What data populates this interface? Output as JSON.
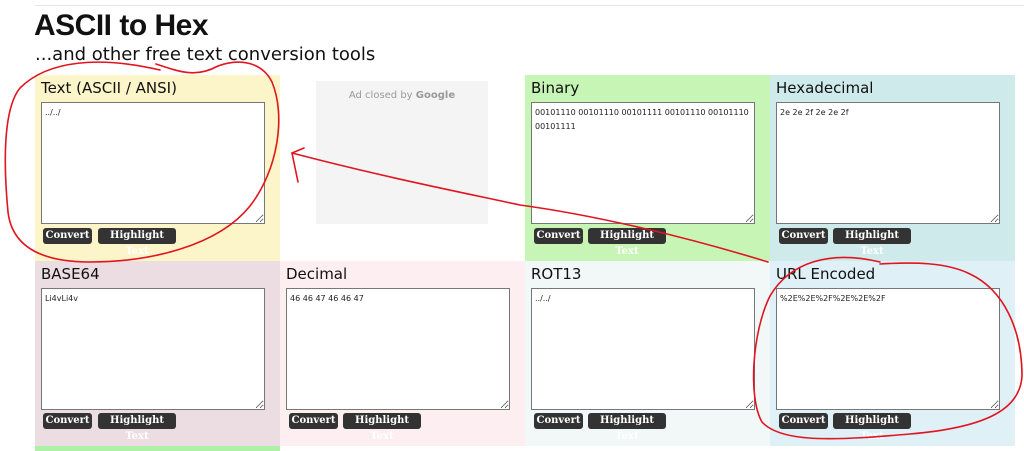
{
  "header": {
    "title": "ASCII to Hex",
    "subtitle": "...and other free text conversion tools"
  },
  "ad": {
    "closed_text": "Ad closed by",
    "brand": "Google"
  },
  "buttons": {
    "convert": "Convert",
    "highlight": "Highlight Text"
  },
  "panels": {
    "ascii": {
      "label": "Text (ASCII / ANSI)",
      "value": "../../",
      "color": "#fbf5c9"
    },
    "binary": {
      "label": "Binary",
      "value": "00101110 00101110 00101111 00101110 00101110 00101111",
      "color": "#c6f5b6"
    },
    "hex": {
      "label": "Hexadecimal",
      "value": "2e 2e 2f 2e 2e 2f",
      "color": "#cfeaea"
    },
    "base64": {
      "label": "BASE64",
      "value": "Li4vLi4v",
      "color": "#ecdde2"
    },
    "decimal": {
      "label": "Decimal",
      "value": "46 46 47 46 46 47",
      "color": "#fdeef1"
    },
    "rot13": {
      "label": "ROT13",
      "value": "../../",
      "color": "#f2f7f8"
    },
    "url": {
      "label": "URL Encoded",
      "value": "%2E%2E%2F%2E%2E%2F",
      "color": "#dff0f7"
    }
  },
  "annotation_color": "#e0151f"
}
